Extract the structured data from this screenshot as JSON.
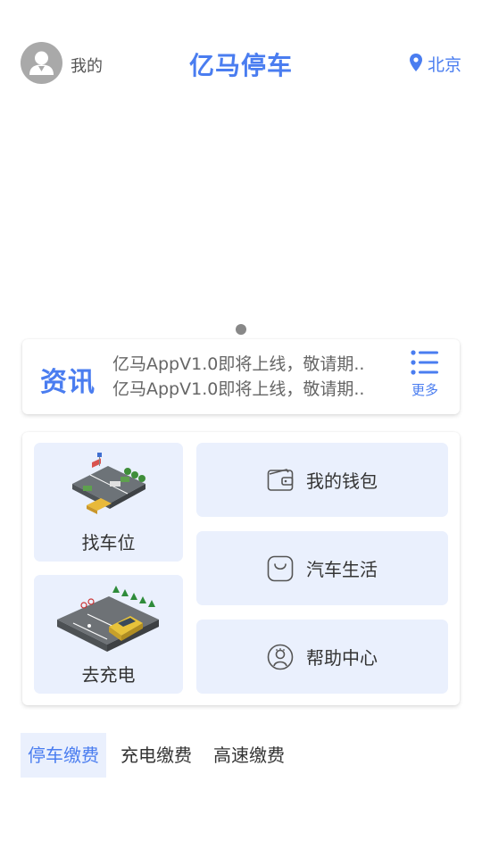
{
  "header": {
    "me_label": "我的",
    "title": "亿马停车",
    "city": "北京",
    "location_icon": "location-pin-icon",
    "avatar_icon": "user-avatar-icon"
  },
  "banner": {
    "active_index": 0,
    "total": 1
  },
  "news": {
    "title": "资讯",
    "items": [
      "亿马AppV1.0即将上线，敬请期..",
      "亿马AppV1.0即将上线，敬请期.."
    ],
    "more_label": "更多",
    "more_icon": "list-icon"
  },
  "services": {
    "find_parking": "找车位",
    "charging": "去充电",
    "wallet": "我的钱包",
    "car_life": "汽车生活",
    "help_center": "帮助中心"
  },
  "payment_tabs": {
    "items": [
      "停车缴费",
      "充电缴费",
      "高速缴费"
    ],
    "active_index": 0
  },
  "colors": {
    "accent": "#4a7df0",
    "tile_bg": "#eaf0fd",
    "avatar_bg": "#a9a9a9"
  }
}
